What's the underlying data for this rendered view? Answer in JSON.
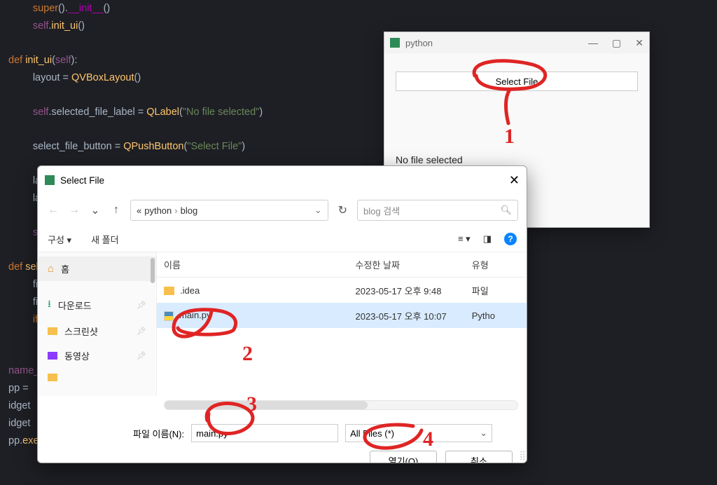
{
  "code": {
    "l0a": "super",
    "l0b": "().",
    "l0c": "__init__",
    "l0d": "()",
    "l1a": "self",
    "l1b": ".",
    "l1c": "init_ui",
    "l1d": "()",
    "l2": "",
    "l3a": "def ",
    "l3b": "init_ui",
    "l3c": "(",
    "l3d": "self",
    "l3e": "):",
    "l4a": "layout = ",
    "l4b": "QVBoxLayout",
    "l4c": "()",
    "l5": "",
    "l6a": "self",
    "l6b": ".selected_file_label = ",
    "l6c": "QLabel",
    "l6d": "(",
    "l6e": "\"No file selected\"",
    "l6f": ")",
    "l7": "",
    "l8a": "select_file_button = ",
    "l8b": "QPushButton",
    "l8c": "(",
    "l8d": "\"Select File\"",
    "l8e": ")",
    "l9": "                                                                    ",
    "l10": "                                                                    ",
    "l11a": "la",
    "l12a": "la",
    "l13": "",
    "l14a": "se",
    "l15": "",
    "l16a": "def ",
    "l16b": "sel",
    "l17": "fil",
    "l18": "fil",
    "l19a": "if",
    "l20": "",
    "l21a": "name_",
    "l22a": "pp = ",
    "l23a": "idget",
    "l24a": "idget",
    "l25a": "pp.",
    "l25b": "exec",
    "l25c": "()"
  },
  "pywin": {
    "title": "python",
    "select_btn": "Select File",
    "msg": "No file selected"
  },
  "dialog": {
    "title": "Select File",
    "path": {
      "root": "«",
      "p1": "python",
      "p2": "blog"
    },
    "search_placeholder": "blog 검색",
    "toolbar": {
      "org": "구성 ▾",
      "newfolder": "새 폴더",
      "help": "?"
    },
    "side": {
      "home": "홈",
      "downloads": "다운로드",
      "screenshots": "스크린샷",
      "videos": "동영상"
    },
    "headers": {
      "name": "이름",
      "date": "수정한 날짜",
      "type": "유형"
    },
    "rows": [
      {
        "name": ".idea",
        "date": "2023-05-17 오후 9:48",
        "type": "파일"
      },
      {
        "name": "main.py",
        "date": "2023-05-17 오후 10:07",
        "type": "Pytho"
      }
    ],
    "filename_label": "파일 이름(N):",
    "filename_value": "main.py",
    "filter": "All Files (*)",
    "open": "열기(O)",
    "cancel": "취소"
  }
}
